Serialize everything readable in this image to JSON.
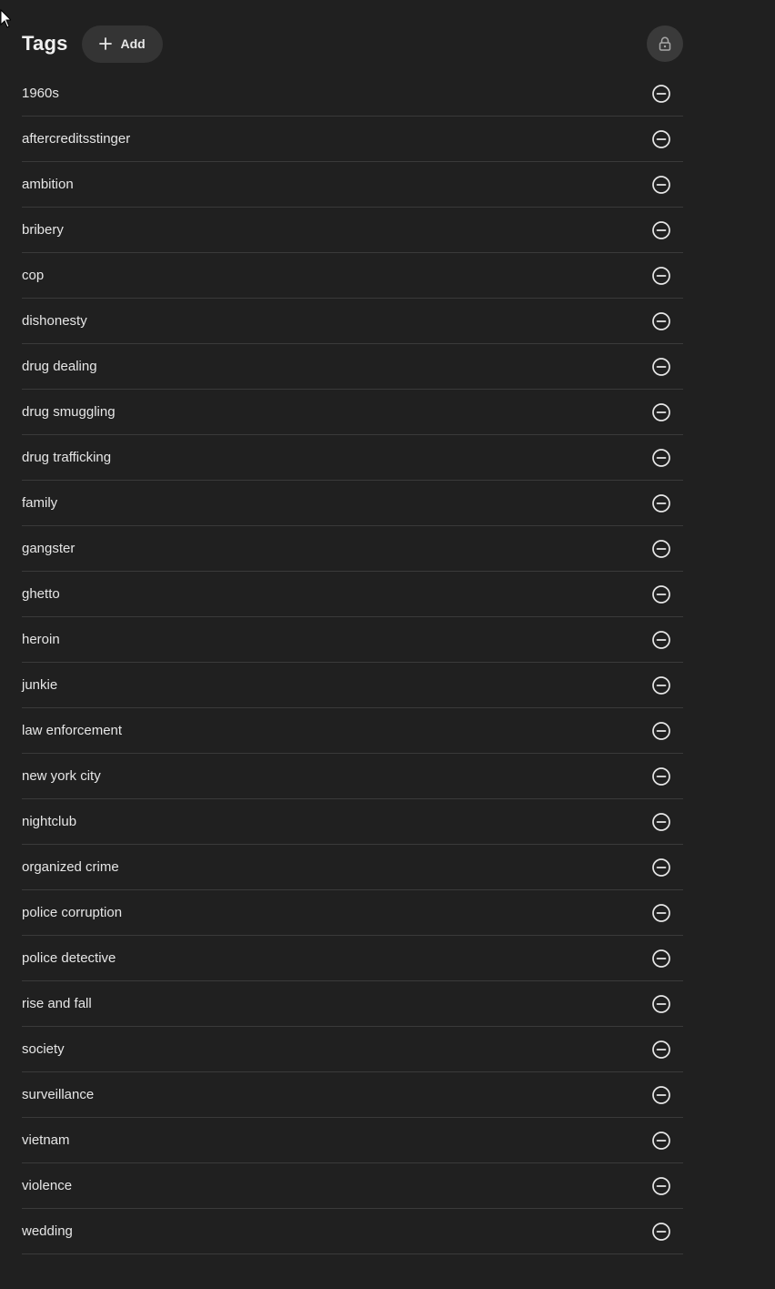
{
  "header": {
    "title": "Tags",
    "add_label": "Add"
  },
  "icons": {
    "add": "plus-icon",
    "lock": "lock-icon",
    "remove": "minus-circle-icon"
  },
  "tags": [
    "1960s",
    "aftercreditsstinger",
    "ambition",
    "bribery",
    "cop",
    "dishonesty",
    "drug dealing",
    "drug smuggling",
    "drug trafficking",
    "family",
    "gangster",
    "ghetto",
    "heroin",
    "junkie",
    "law enforcement",
    "new york city",
    "nightclub",
    "organized crime",
    "police corruption",
    "police detective",
    "rise and fall",
    "society",
    "surveillance",
    "vietnam",
    "violence",
    "wedding"
  ]
}
